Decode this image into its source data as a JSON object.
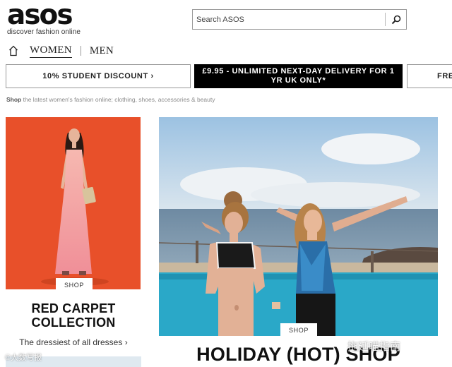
{
  "header": {
    "logo_text": "asos",
    "tagline": "discover fashion online"
  },
  "search": {
    "placeholder": "Search ASOS",
    "icon": "search-icon"
  },
  "nav": {
    "home_icon": "home-icon",
    "items": [
      {
        "label": "WOMEN",
        "active": true
      },
      {
        "label": "MEN",
        "active": false
      }
    ]
  },
  "promos": [
    {
      "label": "10% STUDENT DISCOUNT ›"
    },
    {
      "label": "£9.95 - UNLIMITED NEXT-DAY DELIVERY FOR 1 YR UK ONLY*"
    },
    {
      "label": "FRE"
    }
  ],
  "intro": {
    "bold": "Shop",
    "text": " the latest women's fashion online; clothing, shoes, accessories & beauty"
  },
  "left_card": {
    "shop_label": "SHOP",
    "title_line1": "RED CARPET",
    "title_line2": "COLLECTION",
    "subtitle": "The dressiest of all dresses ›"
  },
  "right_card": {
    "shop_label": "SHOP",
    "title": "HOLIDAY (HOT) SHOP"
  },
  "watermarks": {
    "left": "©大数写报",
    "right": "拖延喵指南"
  },
  "colors": {
    "left_card_bg": "#e8502a",
    "promo_dark_bg": "#000000",
    "sky": "#bcd6ea",
    "pool": "#2aa8c8"
  }
}
